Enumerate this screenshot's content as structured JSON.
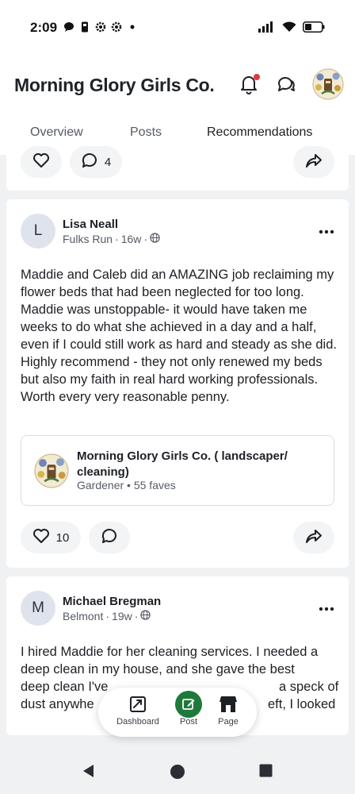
{
  "status_bar": {
    "time": "2:09",
    "left_icons": [
      "chat-bubble-icon",
      "phone-device-icon",
      "gear-icon",
      "gear-icon",
      "dot-icon"
    ],
    "right_icons": [
      "signal-icon",
      "wifi-icon",
      "battery-icon"
    ]
  },
  "header": {
    "title": "Morning Glory Girls Co.",
    "icons": [
      "bell-icon",
      "chat-icon",
      "profile-logo"
    ],
    "notification_dot_color": "#e0393e"
  },
  "tabs": [
    {
      "label": "Overview",
      "active": false
    },
    {
      "label": "Posts",
      "active": false
    },
    {
      "label": "Recommendations",
      "active": true
    }
  ],
  "prev_post": {
    "comment_count": "4"
  },
  "post": {
    "avatar_letter": "L",
    "author": "Lisa Neall",
    "location": "Fulks Run",
    "age": "16w",
    "body": "Maddie and Caleb did an AMAZING job reclaiming my flower beds that had been neglected for too long. Maddie was unstoppable- it would have taken me weeks to do what she achieved in  a day and a half, even if I could still work as hard and steady as she did. Highly recommend - they not only renewed my beds but also my faith in real hard working professionals. Worth every very reasonable penny.",
    "business": {
      "name": "Morning Glory Girls Co. ( landscaper/ cleaning)",
      "category": "Gardener",
      "faves": "55 faves"
    },
    "like_count": "10"
  },
  "post2": {
    "avatar_letter": "M",
    "author": "Michael Bregman",
    "location": "Belmont",
    "age": "19w",
    "body_line1": "I hired Maddie for her cleaning services. I needed a",
    "body_line2": "deep clean in my house, and she gave the best",
    "body_line3_left": "deep clean I've",
    "body_line3_right": "a speck of",
    "body_line4_left": "dust anywhe",
    "body_line4_right": "eft, I looked"
  },
  "bottom_nav": [
    {
      "label": "Dashboard",
      "icon": "dashboard-icon"
    },
    {
      "label": "Post",
      "icon": "compose-icon"
    },
    {
      "label": "Page",
      "icon": "storefront-icon"
    }
  ],
  "colors": {
    "accent_green": "#1e7a3a",
    "text": "#1c1f24",
    "muted": "#555b63"
  }
}
